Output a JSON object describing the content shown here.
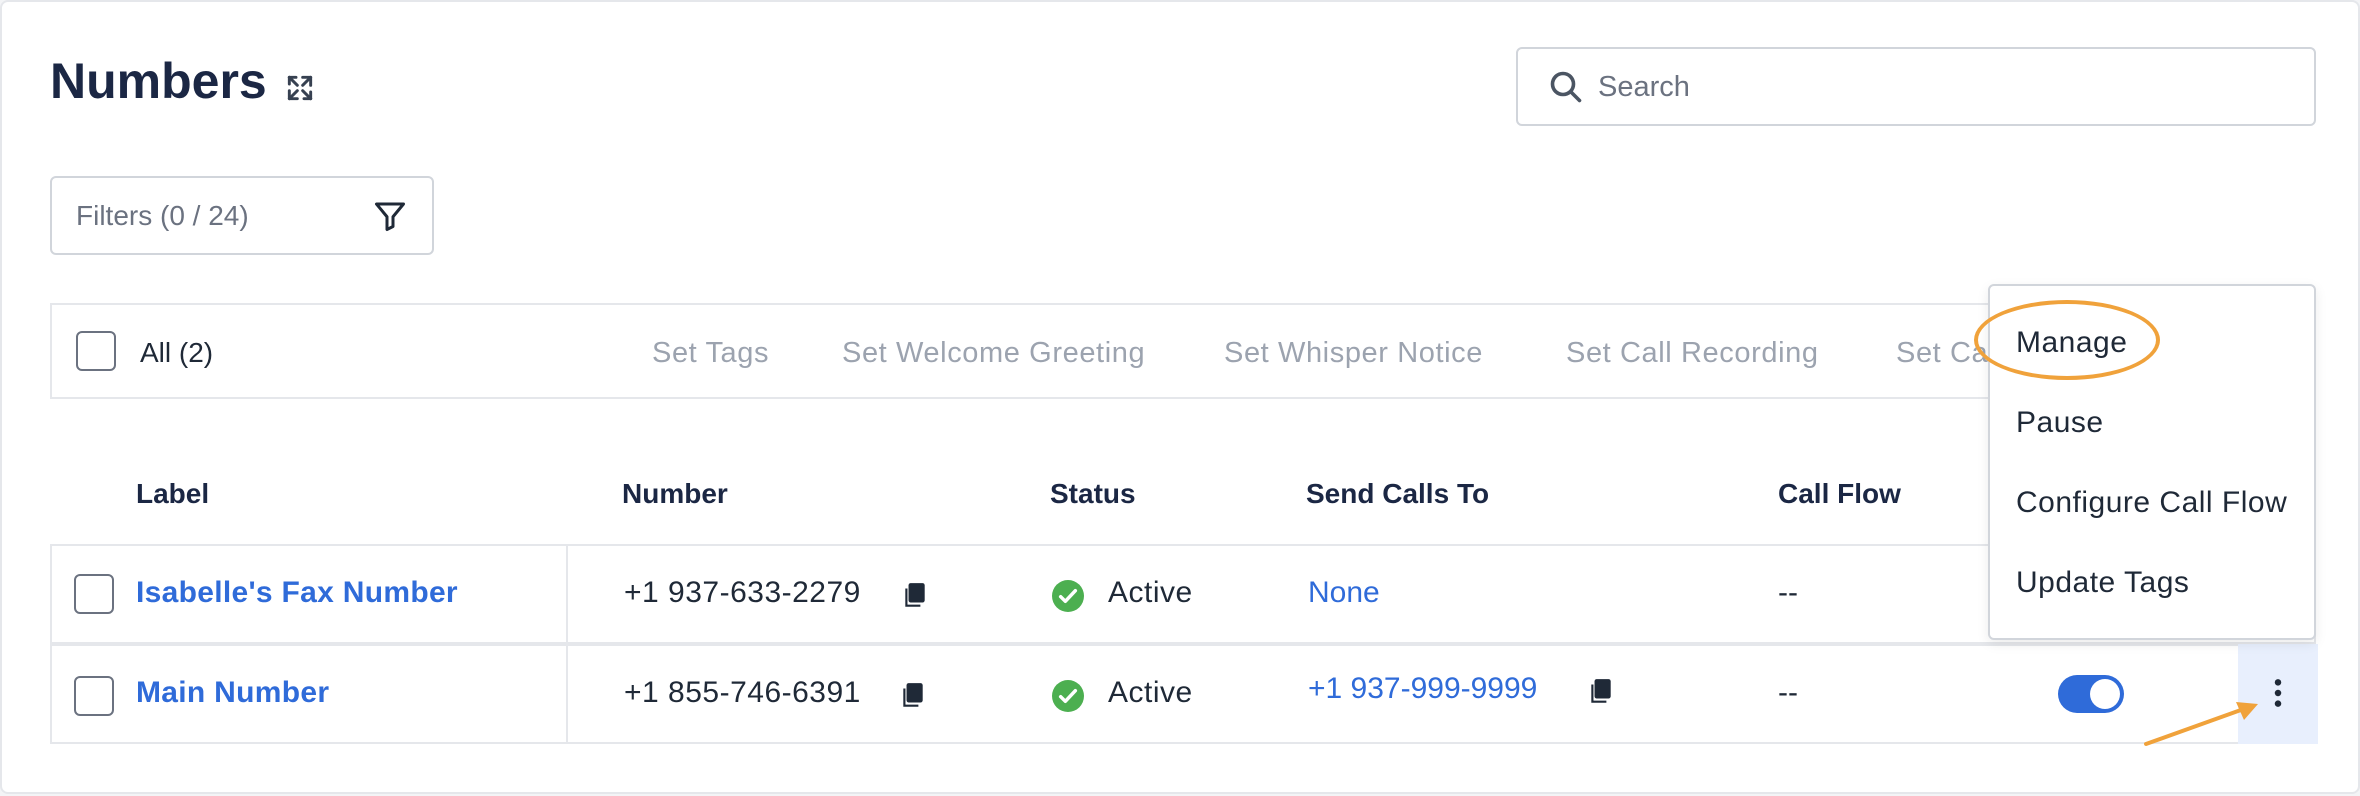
{
  "page": {
    "title": "Numbers"
  },
  "search": {
    "placeholder": "Search"
  },
  "filters": {
    "label": "Filters (0 / 24)"
  },
  "bulk_bar": {
    "select_all_label": "All (2)",
    "actions": [
      "Set Tags",
      "Set Welcome Greeting",
      "Set Whisper Notice",
      "Set Call Recording",
      "Set Call Flow"
    ]
  },
  "table": {
    "columns": {
      "label": "Label",
      "number": "Number",
      "status": "Status",
      "send_calls_to": "Send Calls To",
      "call_flow": "Call Flow"
    },
    "rows": [
      {
        "label": "Isabelle's Fax Number",
        "number": "+1 937-633-2279",
        "status": "Active",
        "send_calls_to": "None",
        "call_flow": "--"
      },
      {
        "label": "Main Number",
        "number": "+1 855-746-6391",
        "status": "Active",
        "send_calls_to": "+1 937-999-9999",
        "call_flow": "--",
        "enabled": true
      }
    ]
  },
  "context_menu": {
    "items": [
      "Manage",
      "Pause",
      "Configure Call Flow",
      "Update Tags"
    ]
  },
  "colors": {
    "accent": "#2f6bd9",
    "active_status": "#4caf50",
    "annotation": "#f0a23b",
    "kebab_highlight": "#e8effd"
  },
  "icons": {
    "expand": "expand-icon",
    "search": "search-icon",
    "filter": "funnel-icon",
    "copy": "copy-icon",
    "status": "check-circle-icon",
    "more": "kebab-vertical-icon"
  }
}
